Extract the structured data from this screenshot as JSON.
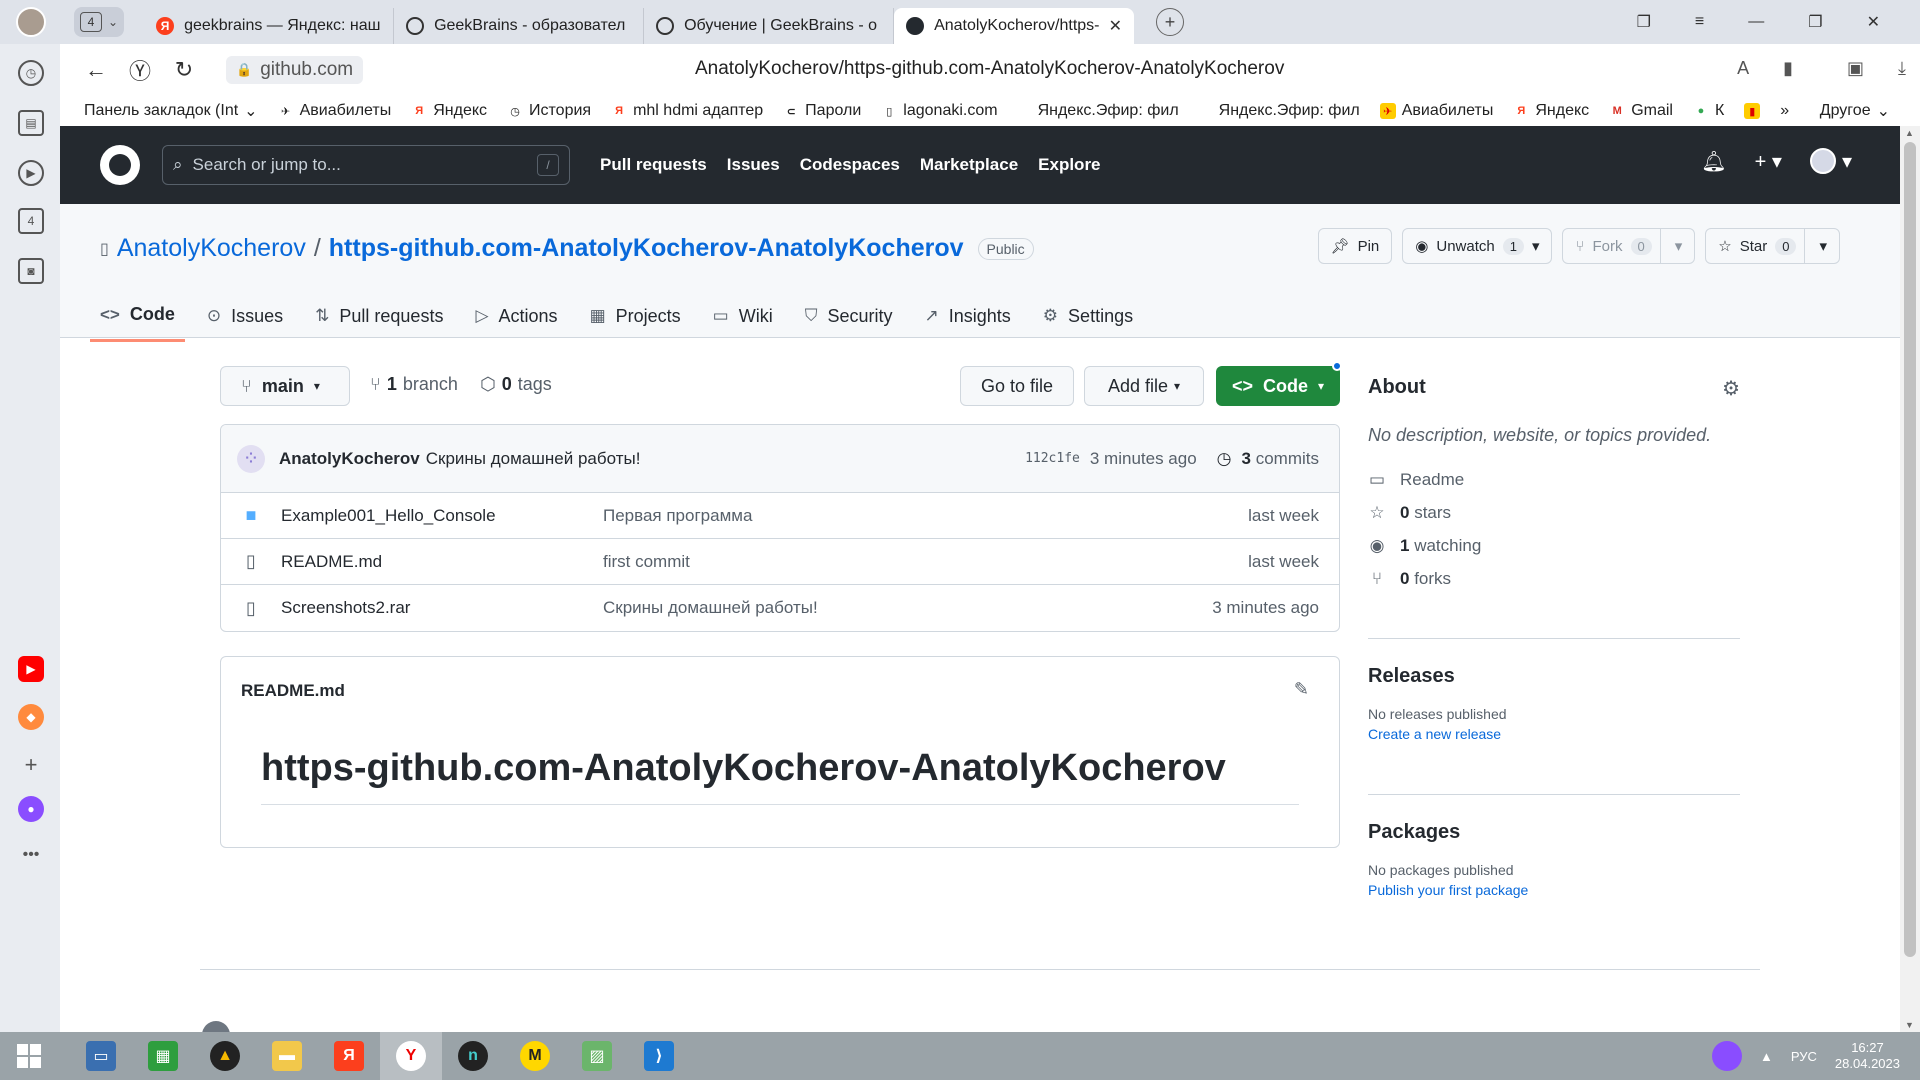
{
  "browser": {
    "tab_count": "4",
    "tabs": [
      {
        "title": "geekbrains — Яндекс: наш",
        "favicon": "yandex-icon"
      },
      {
        "title": "GeekBrains - образовател",
        "favicon": "geekbrains-icon"
      },
      {
        "title": "Обучение | GeekBrains - о",
        "favicon": "geekbrains-icon"
      },
      {
        "title": "AnatolyKocherov/https-",
        "favicon": "github-icon"
      }
    ],
    "host": "github.com",
    "url_path": "AnatolyKocherov/https-github.com-AnatolyKocherov-AnatolyKocherov",
    "bookmarks": [
      {
        "label": "Панель закладок (Int",
        "icon": "folder-icon"
      },
      {
        "label": "Авиабилеты",
        "icon": "plane-icon"
      },
      {
        "label": "Яндекс",
        "icon": "yandex-icon"
      },
      {
        "label": "История",
        "icon": "history-icon"
      },
      {
        "label": "mhl hdmi адаптер",
        "icon": "yandex-icon"
      },
      {
        "label": "Пароли",
        "icon": "key-icon"
      },
      {
        "label": "lagonaki.com",
        "icon": "page-icon"
      },
      {
        "label": "Яндекс.Эфир: фил",
        "icon": "none"
      },
      {
        "label": "Яндекс.Эфир: фил",
        "icon": "none"
      },
      {
        "label": "Авиабилеты",
        "icon": "plane-icon"
      },
      {
        "label": "Яндекс",
        "icon": "yandex-icon"
      },
      {
        "label": "Gmail",
        "icon": "gmail-icon"
      },
      {
        "label": "К",
        "icon": "maps-icon"
      }
    ],
    "bookmarks_more": "Другое"
  },
  "github": {
    "search_placeholder": "Search or jump to...",
    "search_shortcut": "/",
    "nav": [
      "Pull requests",
      "Issues",
      "Codespaces",
      "Marketplace",
      "Explore"
    ],
    "repo_owner": "AnatolyKocherov",
    "repo_sep": "/",
    "repo_name": "https-github.com-AnatolyKocherov-AnatolyKocherov",
    "visibility": "Public",
    "actions": {
      "pin": "Pin",
      "unwatch": "Unwatch",
      "unwatch_count": "1",
      "fork": "Fork",
      "fork_count": "0",
      "star": "Star",
      "star_count": "0"
    },
    "tabs": [
      {
        "label": "Code",
        "icon": "code-icon"
      },
      {
        "label": "Issues",
        "icon": "issue-icon"
      },
      {
        "label": "Pull requests",
        "icon": "pull-request-icon"
      },
      {
        "label": "Actions",
        "icon": "play-icon"
      },
      {
        "label": "Projects",
        "icon": "table-icon"
      },
      {
        "label": "Wiki",
        "icon": "book-icon"
      },
      {
        "label": "Security",
        "icon": "shield-icon"
      },
      {
        "label": "Insights",
        "icon": "graph-icon"
      },
      {
        "label": "Settings",
        "icon": "gear-icon"
      }
    ],
    "branch": "main",
    "branch_count": "1",
    "branch_label": "branch",
    "tag_count": "0",
    "tag_label": "tags",
    "go_to_file": "Go to file",
    "add_file": "Add file",
    "code_button": "Code",
    "commit": {
      "author": "AnatolyKocherov",
      "message": "Скрины домашней работы!",
      "sha": "112c1fe",
      "time": "3 minutes ago",
      "count": "3",
      "count_label": "commits"
    },
    "files": [
      {
        "name": "Example001_Hello_Console",
        "type": "folder",
        "message": "Первая программа",
        "date": "last week"
      },
      {
        "name": "README.md",
        "type": "file",
        "message": "first commit",
        "date": "last week"
      },
      {
        "name": "Screenshots2.rar",
        "type": "file",
        "message": "Скрины домашней работы!",
        "date": "3 minutes ago"
      }
    ],
    "readme": {
      "filename": "README.md",
      "heading": "https-github.com-AnatolyKocherov-AnatolyKocherov"
    },
    "about": {
      "title": "About",
      "description": "No description, website, or topics provided.",
      "readme": "Readme",
      "stars_count": "0",
      "stars_label": "stars",
      "watching_count": "1",
      "watching_label": "watching",
      "forks_count": "0",
      "forks_label": "forks"
    },
    "releases": {
      "title": "Releases",
      "empty": "No releases published",
      "link": "Create a new release"
    },
    "packages": {
      "title": "Packages",
      "empty": "No packages published",
      "link": "Publish your first package"
    }
  },
  "taskbar": {
    "language": "РУС",
    "time": "16:27",
    "date": "28.04.2023"
  }
}
